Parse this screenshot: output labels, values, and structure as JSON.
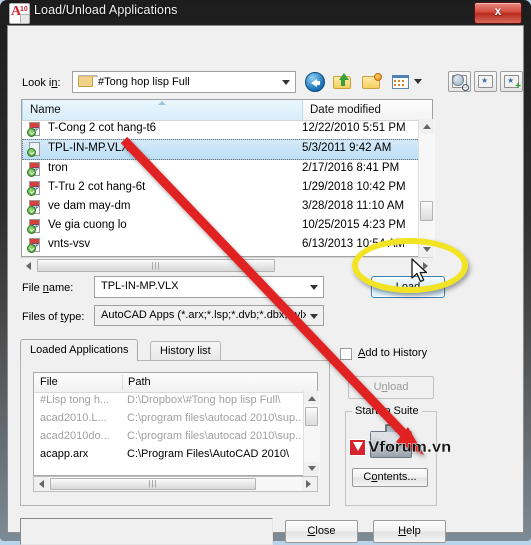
{
  "window": {
    "title": "Load/Unload Applications",
    "app_icon": "autocad-a10-icon",
    "close_label": "x"
  },
  "toolbar": {
    "look_in_label": "Look in:",
    "look_in_value": "#Tong hop lisp Full",
    "icons": [
      {
        "name": "back-icon",
        "label": "Back"
      },
      {
        "name": "up-one-level-icon",
        "label": "Up One Level"
      },
      {
        "name": "create-new-folder-icon",
        "label": "Create New Folder"
      },
      {
        "name": "views-icon",
        "label": "Views"
      },
      {
        "name": "search-web-icon",
        "label": "Search the Web"
      },
      {
        "name": "favorites-icon",
        "label": "Favorites"
      },
      {
        "name": "add-to-favorites-icon",
        "label": "Add to Favorites"
      }
    ]
  },
  "file_list": {
    "columns": [
      "Name",
      "Date modified"
    ],
    "sort_column": "Name",
    "rows": [
      {
        "name": "T-Cong 2 cot hang-t6",
        "date": "12/22/2010 5:51 PM",
        "icon": "lsp-file-icon",
        "selected": false
      },
      {
        "name": "TPL-IN-MP.VLX",
        "date": "5/3/2011 9:42 AM",
        "icon": "vlx-file-icon",
        "selected": true
      },
      {
        "name": "tron",
        "date": "2/17/2016 8:41 PM",
        "icon": "lsp-file-icon",
        "selected": false
      },
      {
        "name": "T-Tru 2 cot hang-6t",
        "date": "1/29/2018 10:42 PM",
        "icon": "lsp-file-icon",
        "selected": false
      },
      {
        "name": "ve dam may-dm",
        "date": "3/28/2018 11:10 AM",
        "icon": "lsp-file-icon",
        "selected": false
      },
      {
        "name": "Ve gia cuong lo",
        "date": "10/25/2015 4:23 PM",
        "icon": "lsp-file-icon",
        "selected": false
      },
      {
        "name": "vnts-vsv",
        "date": "6/13/2013 10:54 AM",
        "icon": "lsp-file-icon",
        "selected": false
      }
    ]
  },
  "fields": {
    "file_name_label": "File name:",
    "file_name_value": "TPL-IN-MP.VLX",
    "files_of_type_label": "Files of type:",
    "files_of_type_value": "AutoCAD Apps (*.arx;*.lsp;*.dvb;*.dbx;*.vlx;*.;"
  },
  "buttons": {
    "load": "Load",
    "unload": "Unload",
    "contents": "Contents...",
    "close": "Close",
    "help": "Help"
  },
  "tabs": [
    {
      "label": "Loaded Applications",
      "active": true
    },
    {
      "label": "History list",
      "active": false
    }
  ],
  "loaded_applications": {
    "columns": [
      "File",
      "Path"
    ],
    "rows": [
      {
        "file": "#Lisp tong h...",
        "path": "D:\\Dropbox\\#Tong hop lisp Full\\",
        "dim": true
      },
      {
        "file": "acad2010.L...",
        "path": "C:\\program files\\autocad 2010\\sup..",
        "dim": true
      },
      {
        "file": "acad2010do...",
        "path": "C:\\program files\\autocad 2010\\sup..",
        "dim": true
      },
      {
        "file": "acapp.arx",
        "path": "C:\\Program Files\\AutoCAD 2010\\",
        "dim": false
      }
    ]
  },
  "options": {
    "add_to_history_label": "Add to History",
    "add_to_history_checked": false,
    "startup_suite_label": "Startup Suite",
    "briefcase_icon": "briefcase-icon"
  },
  "status": {
    "message": ""
  },
  "annotations": {
    "watermark_text": "Vforum.vn",
    "highlight_color": "#f2e423",
    "arrow_color": "#e02020",
    "cursor": "mouse-pointer-icon"
  }
}
